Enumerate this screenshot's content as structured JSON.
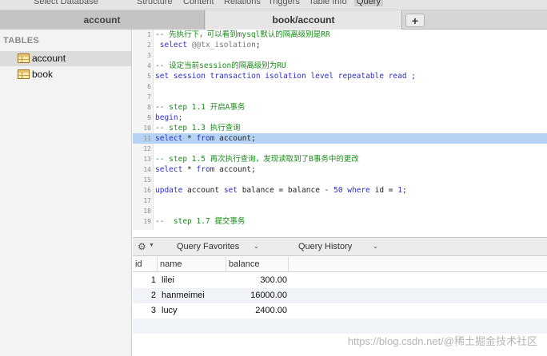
{
  "toolbar": {
    "select_database": "Select Database",
    "structure": "Structure",
    "content": "Content",
    "relations": "Relations",
    "triggers": "Triggers",
    "table_info": "Table Info",
    "query": "Query"
  },
  "tabs": [
    {
      "label": "account"
    },
    {
      "label": "book/account"
    }
  ],
  "add_tab_label": "+",
  "sidebar": {
    "header": "TABLES",
    "items": [
      {
        "label": "account",
        "selected": true
      },
      {
        "label": "book",
        "selected": false
      }
    ]
  },
  "editor": {
    "highlighted_line": 11,
    "lines": [
      {
        "n": "1",
        "text": "-- 先执行下，可以看到mysql默认的隔离级别是RR"
      },
      {
        "n": "2",
        "a": " select ",
        "b": "@@tx_isolation",
        "c": ";"
      },
      {
        "n": "3",
        "text": ""
      },
      {
        "n": "4",
        "text": "-- 设定当前session的隔离级别为RU"
      },
      {
        "n": "5",
        "text": "set session transaction isolation level repeatable read ;"
      },
      {
        "n": "6",
        "text": ""
      },
      {
        "n": "7",
        "text": ""
      },
      {
        "n": "8",
        "text": "-- step 1.1 开启A事务"
      },
      {
        "n": "9",
        "text": "begin;"
      },
      {
        "n": "10",
        "text": "-- step 1.3 执行查询"
      },
      {
        "n": "11",
        "a": "select",
        "b": " * ",
        "c": "from",
        "d": " account;"
      },
      {
        "n": "12",
        "text": ""
      },
      {
        "n": "13",
        "text": "-- step 1.5 再次执行查询，发现读取到了B事务中的更改"
      },
      {
        "n": "14",
        "a": "select",
        "b": " * ",
        "c": "from",
        "d": " account;"
      },
      {
        "n": "15",
        "text": ""
      },
      {
        "n": "16",
        "a": "update",
        "b": " account ",
        "c": "set",
        "d": " balance = balance - ",
        "e": "50",
        "f": " where",
        "g": " id = ",
        "h": "1",
        "i": ";"
      },
      {
        "n": "17",
        "text": ""
      },
      {
        "n": "18",
        "text": ""
      },
      {
        "n": "19",
        "text": "--  step 1.7 提交事务"
      }
    ]
  },
  "results_toolbar": {
    "query_favorites": "Query Favorites",
    "query_history": "Query History"
  },
  "results": {
    "columns": [
      "id",
      "name",
      "balance"
    ],
    "rows": [
      {
        "id": "1",
        "name": "lilei",
        "balance": "300.00"
      },
      {
        "id": "2",
        "name": "hanmeimei",
        "balance": "16000.00"
      },
      {
        "id": "3",
        "name": "lucy",
        "balance": "2400.00"
      }
    ]
  },
  "watermark": "https://blog.csdn.net/@稀土掘金技术社区"
}
